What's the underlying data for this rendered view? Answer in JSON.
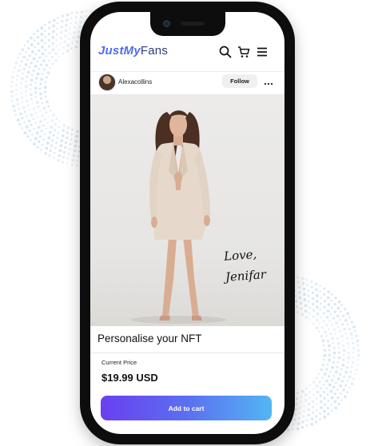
{
  "brand": {
    "logo_part1": "JustMy",
    "logo_part2": "Fans"
  },
  "header": {
    "icons": [
      "search-icon",
      "cart-icon",
      "menu-icon"
    ]
  },
  "post": {
    "username": "Alexacollins",
    "follow_label": "Follow",
    "more_icon": "more-icon"
  },
  "image": {
    "signature_line1": "Love,",
    "signature_line2": "Jenifar"
  },
  "nft": {
    "title": "Personalise your NFT",
    "price_label": "Current Price",
    "price": "$19.99 USD",
    "cta_label": "Add to cart"
  },
  "colors": {
    "accent_start": "#6a3ff0",
    "accent_end": "#52b6f2",
    "logo_blue": "#4f6df0",
    "dots": "#cfe1ee"
  }
}
